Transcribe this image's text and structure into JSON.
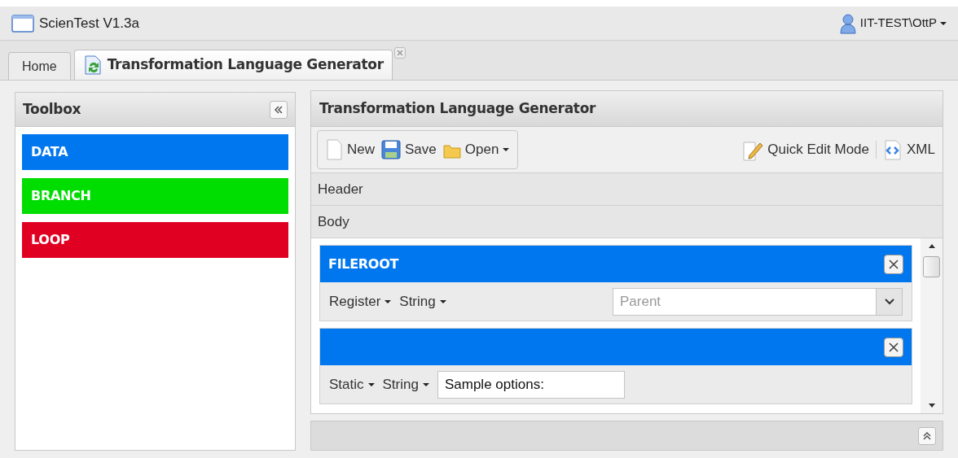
{
  "app": {
    "title": "ScienTest V1.3a",
    "user": "IIT-TEST\\OttP"
  },
  "tabs": [
    {
      "label": "Home",
      "selected": false,
      "closable": false
    },
    {
      "label": "Transformation Language Generator",
      "selected": true,
      "closable": true
    }
  ],
  "toolbox": {
    "title": "Toolbox",
    "items": [
      {
        "label": "DATA",
        "color": "#0077ee"
      },
      {
        "label": "BRANCH",
        "color": "#00dd00"
      },
      {
        "label": "LOOP",
        "color": "#e00022"
      }
    ]
  },
  "generator": {
    "title": "Transformation Language Generator",
    "toolbar_left": [
      {
        "kind": "new",
        "label": "New",
        "menu": false
      },
      {
        "kind": "save",
        "label": "Save",
        "menu": false
      },
      {
        "kind": "open",
        "label": "Open",
        "menu": true
      }
    ],
    "toolbar_right": [
      {
        "kind": "edit",
        "label": "Quick Edit Mode"
      },
      {
        "kind": "xml",
        "label": "XML"
      }
    ],
    "sections": [
      {
        "label": "Header"
      },
      {
        "label": "Body"
      }
    ],
    "blocks": [
      {
        "title": "FILEROOT",
        "color": "#0077ee",
        "fields": [
          {
            "kind": "menu",
            "label": "Register"
          },
          {
            "kind": "menu",
            "label": "String"
          },
          {
            "kind": "combo",
            "placeholder": "Parent"
          }
        ]
      },
      {
        "color": "#0077ee",
        "fields": [
          {
            "kind": "menu",
            "label": "Static"
          },
          {
            "kind": "menu",
            "label": "String"
          },
          {
            "kind": "text",
            "value": "Sample options:"
          }
        ]
      }
    ]
  }
}
